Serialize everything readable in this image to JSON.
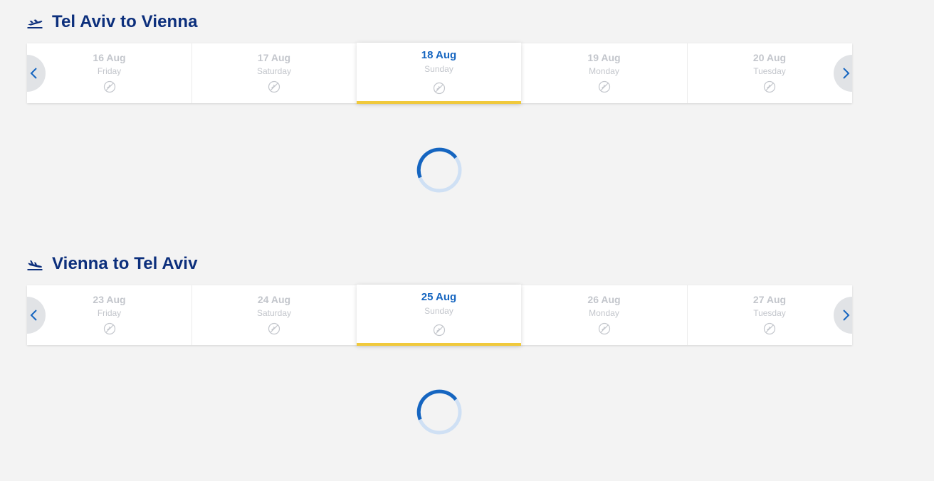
{
  "outbound": {
    "title": "Tel Aviv to Vienna",
    "icon": "plane-departure-icon",
    "days": [
      {
        "date": "16 Aug",
        "weekday": "Friday",
        "selected": false
      },
      {
        "date": "17 Aug",
        "weekday": "Saturday",
        "selected": false
      },
      {
        "date": "18 Aug",
        "weekday": "Sunday",
        "selected": true
      },
      {
        "date": "19 Aug",
        "weekday": "Monday",
        "selected": false
      },
      {
        "date": "20 Aug",
        "weekday": "Tuesday",
        "selected": false
      }
    ],
    "loading": true
  },
  "return": {
    "title": "Vienna to Tel Aviv",
    "icon": "plane-arrival-icon",
    "days": [
      {
        "date": "23 Aug",
        "weekday": "Friday",
        "selected": false
      },
      {
        "date": "24 Aug",
        "weekday": "Saturday",
        "selected": false
      },
      {
        "date": "25 Aug",
        "weekday": "Sunday",
        "selected": true
      },
      {
        "date": "26 Aug",
        "weekday": "Monday",
        "selected": false
      },
      {
        "date": "27 Aug",
        "weekday": "Tuesday",
        "selected": false
      }
    ],
    "loading": true
  },
  "icons": {
    "day_status": "no-flights-icon",
    "prev": "chevron-left-icon",
    "next": "chevron-right-icon",
    "loading": "loading-spinner-icon"
  },
  "colors": {
    "title": "#0c2f7c",
    "accent": "#1565c0",
    "selected_bar": "#f0c93c",
    "muted_text": "#c3c6cc",
    "background": "#f3f3f3",
    "nav_button": "#e1e3e6"
  }
}
